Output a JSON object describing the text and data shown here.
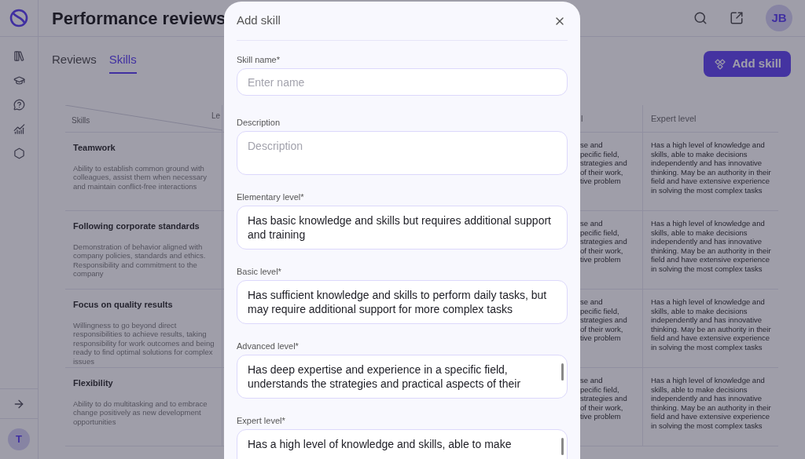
{
  "header": {
    "title": "Performance reviews",
    "user_initials": "JB"
  },
  "sidebar": {
    "user_initial": "T"
  },
  "tabs": [
    {
      "label": "Reviews",
      "selected": false
    },
    {
      "label": "Skills",
      "selected": true
    }
  ],
  "add_button": "Add skill",
  "table": {
    "corner_top": "Le",
    "corner_bottom": "Skills",
    "column_3": "l",
    "expert_header": "Expert level",
    "rows": [
      {
        "name": "Teamwork",
        "description": "Ability to establish common ground with colleagues, assist them when necessary and maintain conflict-free interactions",
        "column_3": [
          "se and",
          "pecific field,",
          "strategies and",
          "of their work,",
          "tive problem"
        ],
        "expert": "Has a high level of knowledge and skills, able to make decisions independently and has innovative thinking. May be an authority in their field and have extensive experience in solving the most complex tasks"
      },
      {
        "name": "Following corporate standards",
        "description": "Demonstration of behavior aligned with company policies, standards and ethics. Responsibility and commitment to the company",
        "column_3": [
          "se and",
          "pecific field,",
          "strategies and",
          "of their work,",
          "tive problem"
        ],
        "expert": "Has a high level of knowledge and skills, able to make decisions independently and has innovative thinking. May be an authority in their field and have extensive experience in solving the most complex tasks"
      },
      {
        "name": "Focus on quality results",
        "description": "Willingness to go beyond direct responsibilities to achieve results, taking responsibility for work outcomes and being ready to find optimal solutions for complex issues",
        "column_3": [
          "se and",
          "pecific field,",
          "strategies and",
          "of their work,",
          "tive problem"
        ],
        "expert": "Has a high level of knowledge and skills, able to make decisions independently and has innovative thinking. May be an authority in their field and have extensive experience in solving the most complex tasks"
      },
      {
        "name": "Flexibility",
        "description": "Ability to do multitasking and to embrace change positively as new development opportunities",
        "column_3": [
          "se and",
          "pecific field,",
          "strategies and",
          "of their work,",
          "tive problem"
        ],
        "expert": "Has a high level of knowledge and skills, able to make decisions independently and has innovative thinking. May be an authority in their field and have extensive experience in solving the most complex tasks"
      }
    ]
  },
  "modal": {
    "title": "Add skill",
    "fields": [
      {
        "label": "Skill name*",
        "kind": "input",
        "placeholder": "Enter name"
      },
      {
        "label": "Description",
        "kind": "textarea",
        "placeholder": "Description"
      },
      {
        "label": "Elementary level*",
        "kind": "textarea",
        "value": "Has basic knowledge and skills but requires additional support and training"
      },
      {
        "label": "Basic level*",
        "kind": "textarea",
        "value": "Has sufficient knowledge and skills to perform daily tasks, but may require additional support for more complex tasks"
      },
      {
        "label": "Advanced level*",
        "kind": "textarea",
        "value": "Has deep expertise and experience in a specific field, understands the strategies and practical aspects of their",
        "scrollable": true
      },
      {
        "label": "Expert level*",
        "kind": "textarea",
        "value": "Has a high level of knowledge and skills, able to make",
        "scrollable": true
      }
    ]
  }
}
